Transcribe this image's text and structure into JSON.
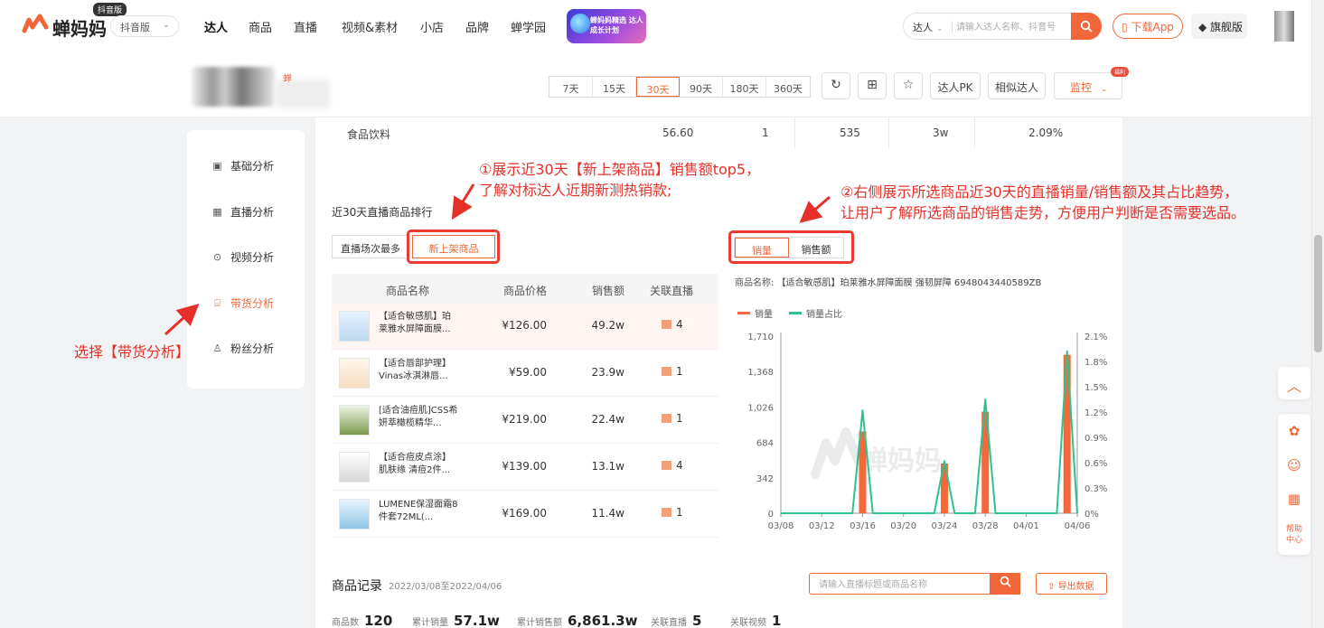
{
  "header": {
    "logo_text": "蝉妈妈",
    "logo_badge": "抖音版",
    "version_select": "抖音版",
    "nav": [
      "达人",
      "商品",
      "直播",
      "视频&素材",
      "小店",
      "品牌",
      "蝉学园"
    ],
    "promo_text": "蝉妈妈精选 达人成长计划",
    "search_type": "达人",
    "search_placeholder": "请输入达人名称、抖音号",
    "download_app": "下载App",
    "flagship": "旗舰版"
  },
  "subheader": {
    "name_tag": "蝉",
    "periods": [
      "7天",
      "15天",
      "30天",
      "90天",
      "180天",
      "360天"
    ],
    "active_period": "30天",
    "buttons": [
      "达人PK",
      "相似达人"
    ],
    "monitor": "监控",
    "monitor_badge": "福利"
  },
  "sidebar": {
    "items": [
      {
        "label": "基础分析",
        "icon": "chart-icon"
      },
      {
        "label": "直播分析",
        "icon": "live-icon"
      },
      {
        "label": "视频分析",
        "icon": "play-icon"
      },
      {
        "label": "带货分析",
        "icon": "bag-icon"
      },
      {
        "label": "粉丝分析",
        "icon": "fans-icon"
      }
    ]
  },
  "top_row": {
    "category": "食品饮料",
    "c1": "56.60",
    "c2": "1",
    "c3": "535",
    "c4": "3w",
    "c5": "2.09%"
  },
  "ranking": {
    "title": "近30天直播商品排行",
    "tabs": [
      "直播场次最多",
      "新上架商品"
    ],
    "active_tab": "新上架商品",
    "columns": [
      "商品名称",
      "商品价格",
      "销售额",
      "关联直播"
    ],
    "rows": [
      {
        "name": "【适合敏感肌】珀莱雅水屏障面膜...",
        "price": "¥126.00",
        "sales": "49.2w",
        "live": "4"
      },
      {
        "name": "【适合唇部护理】Vinas冰淇淋唇...",
        "price": "¥59.00",
        "sales": "23.9w",
        "live": "1"
      },
      {
        "name": "[适合油痘肌]CSS希妍萃橄榄精华...",
        "price": "¥219.00",
        "sales": "22.4w",
        "live": "1"
      },
      {
        "name": "【适合痘皮点涂】肌肤缘 清痘2件...",
        "price": "¥139.00",
        "sales": "13.1w",
        "live": "4"
      },
      {
        "name": "LUMENE保湿面霜8件套72ML(...",
        "price": "¥169.00",
        "sales": "11.4w",
        "live": "1"
      }
    ]
  },
  "annotations": {
    "a1_line1": "①展示近30天【新上架商品】销售额top5，",
    "a1_line2": "了解对标达人近期新测热销款;",
    "a2_line1": "②右侧展示所选商品近30天的直播销量/销售额及其占比趋势，",
    "a2_line2": "让用户了解所选商品的销售走势，方便用户判断是否需要选品。",
    "a3": "选择【带货分析】"
  },
  "chart_panel": {
    "tabs": [
      "销量",
      "销售额"
    ],
    "active_tab": "销量",
    "product_label": "商品名称:",
    "product_name": "【适合敏感肌】珀莱雅水屏障面膜 强韧屏障 6948043440589ZB",
    "watermark": "蝉妈妈"
  },
  "chart_data": {
    "type": "bar",
    "x": [
      "03/08",
      "03/09",
      "03/10",
      "03/11",
      "03/12",
      "03/13",
      "03/14",
      "03/15",
      "03/16",
      "03/17",
      "03/18",
      "03/19",
      "03/20",
      "03/21",
      "03/22",
      "03/23",
      "03/24",
      "03/25",
      "03/26",
      "03/27",
      "03/28",
      "03/29",
      "03/30",
      "03/31",
      "04/01",
      "04/02",
      "04/03",
      "04/04",
      "04/05",
      "04/06"
    ],
    "x_tick_labels": [
      "03/08",
      "03/12",
      "03/16",
      "03/20",
      "03/24",
      "03/28",
      "04/01",
      "04/06"
    ],
    "series": [
      {
        "name": "销量",
        "type": "bar",
        "color": "#f4683a",
        "values": [
          0,
          0,
          0,
          0,
          0,
          0,
          0,
          0,
          790,
          0,
          0,
          0,
          0,
          0,
          0,
          0,
          480,
          0,
          0,
          0,
          980,
          0,
          0,
          0,
          0,
          0,
          0,
          0,
          1530,
          0
        ]
      },
      {
        "name": "销量占比",
        "type": "line",
        "color": "#2ec28f",
        "values": [
          0,
          0,
          0,
          0,
          0,
          0,
          0,
          0,
          1.22,
          0,
          0,
          0,
          0,
          0,
          0,
          0,
          0.62,
          0,
          0,
          0,
          1.35,
          0,
          0,
          0,
          0,
          0,
          0,
          0,
          1.92,
          0
        ]
      }
    ],
    "y_left_ticks": [
      "0",
      "342",
      "684",
      "1,026",
      "1,368",
      "1,710"
    ],
    "y_right_ticks": [
      "0%",
      "0.3%",
      "0.6%",
      "0.9%",
      "1.2%",
      "1.5%",
      "1.8%",
      "2.1%"
    ],
    "ylim_left": [
      0,
      1710
    ],
    "ylim_right": [
      0,
      2.1
    ],
    "legend_position": "top-left"
  },
  "records": {
    "title": "商品记录",
    "range": "2022/03/08至2022/04/06",
    "search_placeholder": "请输入直播标题或商品名称",
    "export": "导出数据",
    "stats": [
      {
        "label": "商品数",
        "value": "120"
      },
      {
        "label": "累计销量",
        "value": "57.1w"
      },
      {
        "label": "累计销售额",
        "value": "6,861.3w"
      },
      {
        "label": "关联直播",
        "value": "5"
      },
      {
        "label": "关联视频",
        "value": "1"
      }
    ]
  },
  "floating": {
    "help": "帮助中心"
  }
}
